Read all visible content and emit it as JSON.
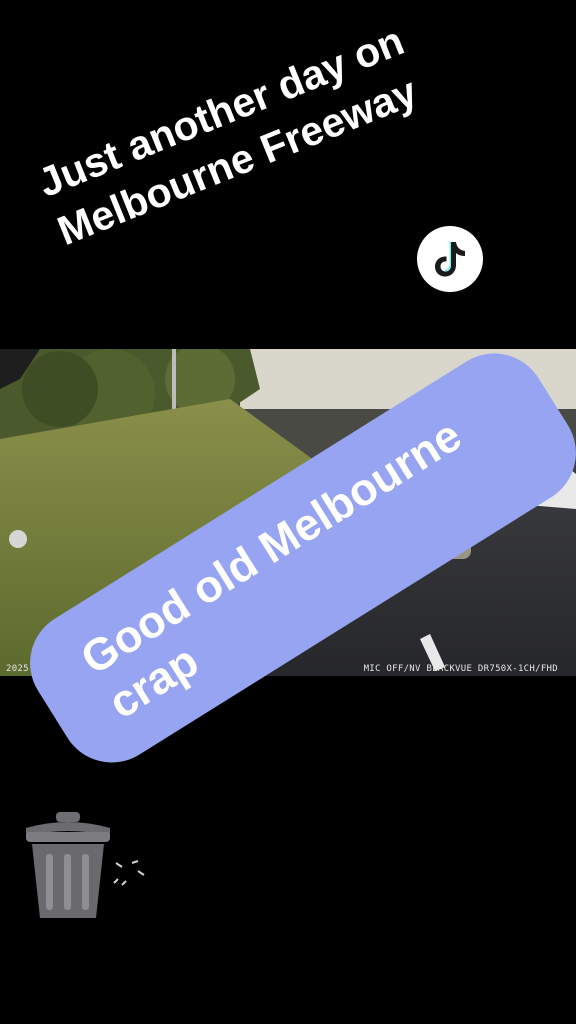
{
  "caption": {
    "line1": "Just another day on",
    "line2": "Melbourne Freeway"
  },
  "sticker": {
    "text": "Good old Melbourne crap"
  },
  "video": {
    "timestamp": "2025-10-0",
    "camera_info": "MIC OFF/NV  BLACKVUE DR750X-1CH/FHD"
  },
  "icons": {
    "tiktok": "tiktok-logo-icon",
    "trash": "trash-can-icon"
  },
  "colors": {
    "background": "#000000",
    "sticker": "#97a4f1",
    "text": "#ffffff"
  }
}
